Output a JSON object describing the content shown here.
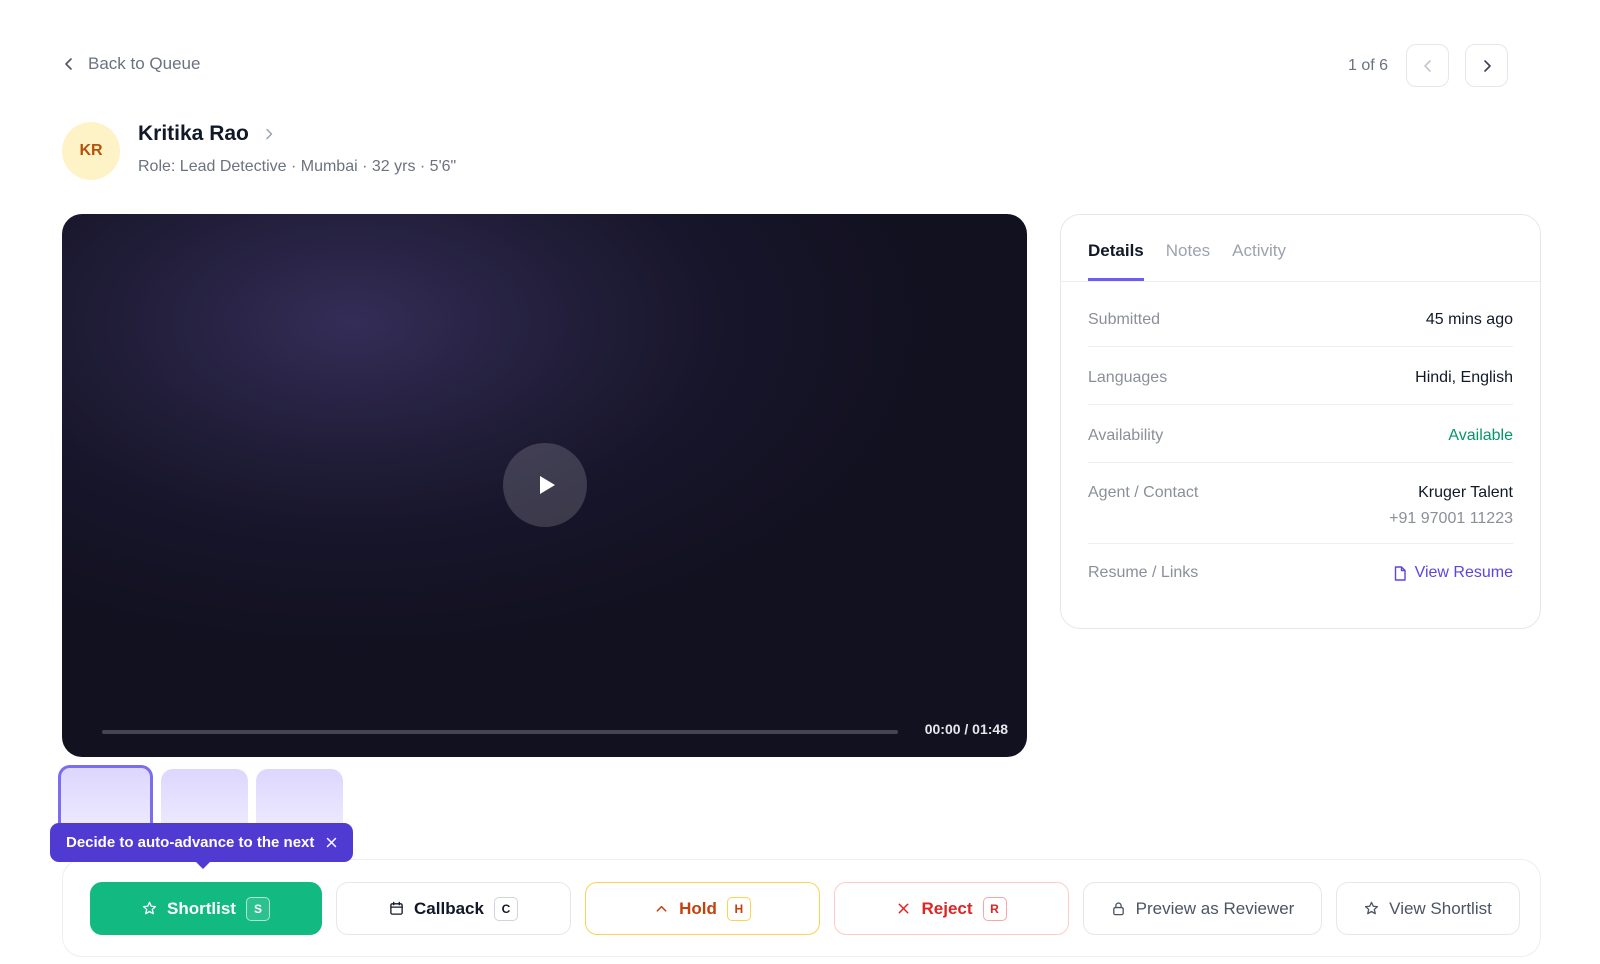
{
  "nav": {
    "back_label": "Back to Queue",
    "pager_count": "1 of 6"
  },
  "candidate": {
    "initials": "KR",
    "name": "Kritika Rao",
    "meta": "Role: Lead Detective · Mumbai · 32 yrs · 5'6\""
  },
  "video": {
    "time": "00:00 / 01:48",
    "progress": 0
  },
  "thumbnails": [
    {
      "active": true
    },
    {
      "active": false
    },
    {
      "active": false
    }
  ],
  "tooltip": {
    "text": "Decide to auto-advance to the next"
  },
  "details": {
    "tabs": [
      {
        "label": "Details",
        "active": true
      },
      {
        "label": "Notes",
        "active": false
      },
      {
        "label": "Activity",
        "active": false
      }
    ],
    "submitted_label": "Submitted",
    "submitted_value": "45 mins ago",
    "languages_label": "Languages",
    "languages_value": "Hindi, English",
    "availability_label": "Availability",
    "availability_value": "Available",
    "agent_label": "Agent / Contact",
    "agent_value": "Kruger Talent",
    "agent_phone": "+91 97001 11223",
    "resume_label": "Resume / Links",
    "resume_link": "View Resume"
  },
  "actions": {
    "shortlist_label": "Shortlist",
    "shortlist_key": "S",
    "callback_label": "Callback",
    "callback_key": "C",
    "hold_label": "Hold",
    "hold_key": "H",
    "reject_label": "Reject",
    "reject_key": "R",
    "preview_label": "Preview as Reviewer",
    "view_shortlist_label": "View Shortlist"
  },
  "colors": {
    "accent": "#6d5cf5",
    "shortlist": "#12b981",
    "hold": "#c2410c",
    "reject": "#dc2626",
    "available": "#059669",
    "tooltip": "#4f3bd1"
  },
  "icons": {
    "back": "chevron-left-icon",
    "prev": "chevron-left-icon",
    "next": "chevron-right-icon",
    "candidate_expand": "chevron-right-icon",
    "play": "play-icon",
    "tooltip_close": "close-icon",
    "resume": "file-icon",
    "shortlist": "star-icon",
    "callback": "calendar-icon",
    "hold": "chevron-up-icon",
    "reject": "x-icon",
    "preview": "lock-icon",
    "view_shortlist": "star-icon"
  }
}
